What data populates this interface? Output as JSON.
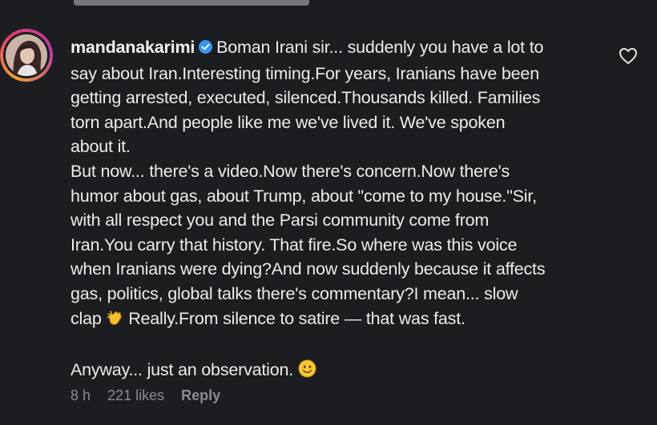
{
  "comment": {
    "username": "mandanakarimi",
    "verified": true,
    "lines": [
      "Boman Irani sir... suddenly you have a lot to",
      "say about Iran.Interesting timing.For years, Iranians have been",
      "getting arrested, executed, silenced.Thousands killed. Families",
      "torn apart.And people like me we've lived it. We've spoken",
      "about it.",
      "But now... there's a video.Now there's concern.Now there's",
      "humor about gas, about Trump, about \"come to my house.\"Sir,",
      "with all respect you and the Parsi community come from",
      "Iran.You carry that history. That fire.So where was this voice",
      "when Iranians were dying?And now suddenly because it affects",
      "gas, politics, global talks there's commentary?I mean... slow",
      "clap",
      "Really.From silence to satire — that was fast.",
      "Anyway... just an observation."
    ],
    "clap_emoji": "clapping-hands-emoji",
    "smile_emoji": "smiling-face-emoji",
    "time": "8 h",
    "likes": "221 likes",
    "reply_label": "Reply",
    "like_icon": "heart-outline-icon"
  },
  "colors": {
    "background": "#1c1d20",
    "text": "#ececec",
    "meta": "#8a8b90",
    "verified_badge": "#3797f0"
  }
}
